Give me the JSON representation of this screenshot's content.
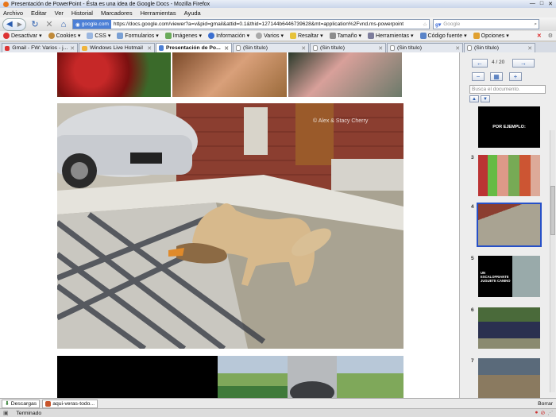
{
  "window": {
    "title": "Presentación de PowerPoint - Ésta es una idea de Google Docs - Mozilla Firefox"
  },
  "menu": [
    "Archivo",
    "Editar",
    "Ver",
    "Historial",
    "Marcadores",
    "Herramientas",
    "Ayuda"
  ],
  "nav": {
    "site_badge": "google.com",
    "url": "https://docs.google.com/viewer?a=v&pid=gmail&attid=0.1&thid=127144b6446739628&mt=application%2Fvnd.ms-powerpoint",
    "search_placeholder": "Google"
  },
  "bookmarks": [
    "Desactivar",
    "Cookies",
    "CSS",
    "Formularios",
    "Imágenes",
    "Información",
    "Varios",
    "Resaltar",
    "Tamaño",
    "Herramientas",
    "Código fuente",
    "Opciones"
  ],
  "tabs": [
    {
      "label": "Gmail - FW: Varios - j...",
      "active": false
    },
    {
      "label": "Windows Live Hotmail",
      "active": false
    },
    {
      "label": "Presentación de Po...",
      "active": true
    },
    {
      "label": "(Sin título)",
      "active": false
    },
    {
      "label": "(Sin título)",
      "active": false
    },
    {
      "label": "(Sin título)",
      "active": false
    },
    {
      "label": "(Sin título)",
      "active": false
    }
  ],
  "viewer": {
    "page_counter": "4 / 20",
    "search_placeholder": "Busca el documento.",
    "thumbnails": [
      {
        "number": "",
        "caption": "POR EJEMPLO:",
        "selected": false
      },
      {
        "number": "3",
        "caption": "",
        "selected": false
      },
      {
        "number": "4",
        "caption": "",
        "selected": true
      },
      {
        "number": "5",
        "caption": "UN ESCALOFRIANTE JUGUETE CANINO",
        "selected": false
      },
      {
        "number": "6",
        "caption": "",
        "selected": false
      },
      {
        "number": "7",
        "caption": "",
        "selected": false
      }
    ]
  },
  "downloads": {
    "button": "Descargas",
    "item": "aqui-veras-todo...",
    "close": "Borrar"
  },
  "status": {
    "text": "Terminado"
  },
  "colors": {
    "accent": "#2650c8",
    "link_badge": "#4c7fd6"
  }
}
